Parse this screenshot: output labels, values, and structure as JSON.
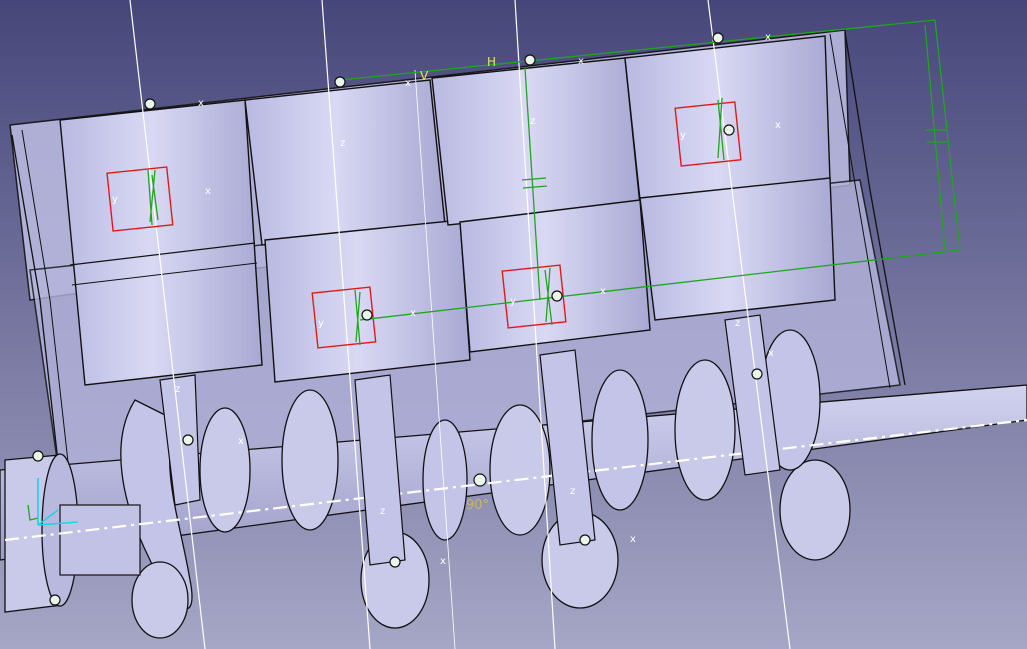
{
  "viewer": {
    "colors": {
      "background_top": "#46467a",
      "background_bottom": "#a6a6c6",
      "part_fill": "#c9c9ea",
      "part_fill_dark": "#a9a9d2",
      "edge": "#111111",
      "axis_line": "#ffffff",
      "constraint": "#1fa51f",
      "selection_box": "#e01a1a",
      "tag_text": "#ffffff",
      "dim_text": "#e6e65a",
      "angle_text": "#c8b860",
      "triad": "#1fd3e6"
    },
    "annotations": {
      "h_label": "H",
      "v_label": "V",
      "angle_label": "90°",
      "axis_x": "x",
      "axis_y": "y",
      "axis_z": "z"
    }
  }
}
